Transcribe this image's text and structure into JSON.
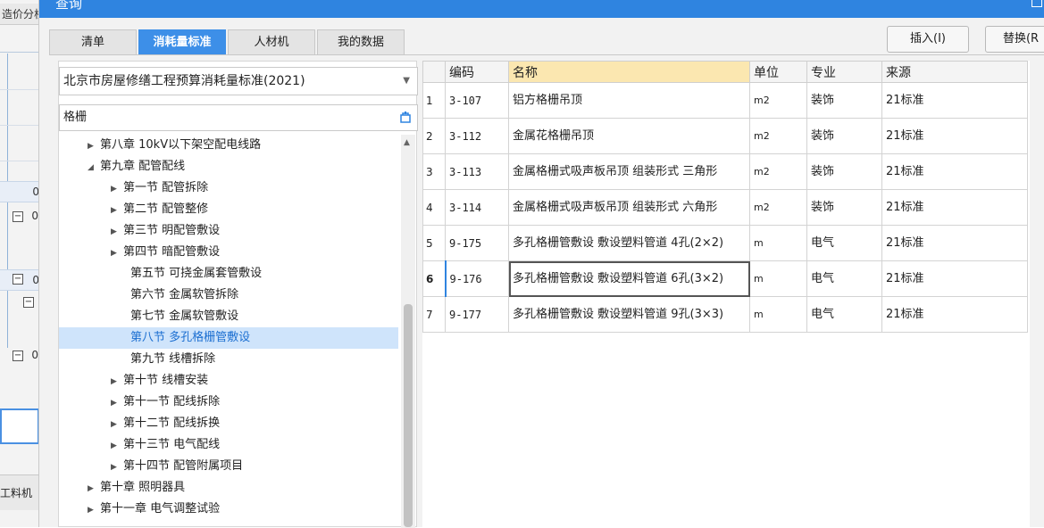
{
  "background": {
    "title_fragment": "造价分析",
    "bottom_fragment": "工料机",
    "row_numbers": [
      "0",
      "0",
      "0",
      "0"
    ]
  },
  "dialog": {
    "title": "查询",
    "tabs": [
      {
        "label": "清单"
      },
      {
        "label": "消耗量标准"
      },
      {
        "label": "人材机"
      },
      {
        "label": "我的数据"
      }
    ],
    "active_tab": 1,
    "buttons": {
      "insert": "插入(I)",
      "replace": "替换(R"
    }
  },
  "left_panel": {
    "standard_select_value": "北京市房屋修缮工程预算消耗量标准(2021)",
    "search_value": "格栅",
    "tree": [
      {
        "label": "第八章 10kV以下架空配电线路",
        "level": 1,
        "state": "collapsed"
      },
      {
        "label": "第九章 配管配线",
        "level": 1,
        "state": "expanded"
      },
      {
        "label": "第一节 配管拆除",
        "level": 2,
        "state": "collapsed"
      },
      {
        "label": "第二节 配管整修",
        "level": 2,
        "state": "collapsed"
      },
      {
        "label": "第三节 明配管敷设",
        "level": 2,
        "state": "collapsed"
      },
      {
        "label": "第四节 暗配管敷设",
        "level": 2,
        "state": "collapsed"
      },
      {
        "label": "第五节 可挠金属套管敷设",
        "level": 2,
        "state": "leaf"
      },
      {
        "label": "第六节 金属软管拆除",
        "level": 2,
        "state": "leaf"
      },
      {
        "label": "第七节 金属软管敷设",
        "level": 2,
        "state": "leaf"
      },
      {
        "label": "第八节 多孔格栅管敷设",
        "level": 2,
        "state": "leaf",
        "selected": true
      },
      {
        "label": "第九节 线槽拆除",
        "level": 2,
        "state": "leaf"
      },
      {
        "label": "第十节 线槽安装",
        "level": 2,
        "state": "collapsed"
      },
      {
        "label": "第十一节 配线拆除",
        "level": 2,
        "state": "collapsed"
      },
      {
        "label": "第十二节 配线拆换",
        "level": 2,
        "state": "collapsed"
      },
      {
        "label": "第十三节 电气配线",
        "level": 2,
        "state": "collapsed"
      },
      {
        "label": "第十四节 配管附属项目",
        "level": 2,
        "state": "collapsed"
      },
      {
        "label": "第十章 照明器具",
        "level": 1,
        "state": "collapsed"
      },
      {
        "label": "第十一章 电气调整试验",
        "level": 1,
        "state": "collapsed"
      }
    ]
  },
  "table": {
    "headers": [
      "",
      "编码",
      "名称",
      "单位",
      "专业",
      "来源"
    ],
    "rows": [
      {
        "num": "1",
        "code": "3-107",
        "name": "铝方格栅吊顶",
        "unit": "m2",
        "major": "装饰",
        "source": "21标准"
      },
      {
        "num": "2",
        "code": "3-112",
        "name": "金属花格栅吊顶",
        "unit": "m2",
        "major": "装饰",
        "source": "21标准"
      },
      {
        "num": "3",
        "code": "3-113",
        "name": "金属格栅式吸声板吊顶 组装形式 三角形",
        "unit": "m2",
        "major": "装饰",
        "source": "21标准"
      },
      {
        "num": "4",
        "code": "3-114",
        "name": "金属格栅式吸声板吊顶 组装形式 六角形",
        "unit": "m2",
        "major": "装饰",
        "source": "21标准"
      },
      {
        "num": "5",
        "code": "9-175",
        "name": "多孔格栅管敷设 敷设塑料管道 4孔(2×2)",
        "unit": "m",
        "major": "电气",
        "source": "21标准"
      },
      {
        "num": "6",
        "code": "9-176",
        "name": "多孔格栅管敷设 敷设塑料管道 6孔(3×2)",
        "unit": "m",
        "major": "电气",
        "source": "21标准",
        "selected": true
      },
      {
        "num": "7",
        "code": "9-177",
        "name": "多孔格栅管敷设 敷设塑料管道 9孔(3×3)",
        "unit": "m",
        "major": "电气",
        "source": "21标准"
      }
    ]
  }
}
